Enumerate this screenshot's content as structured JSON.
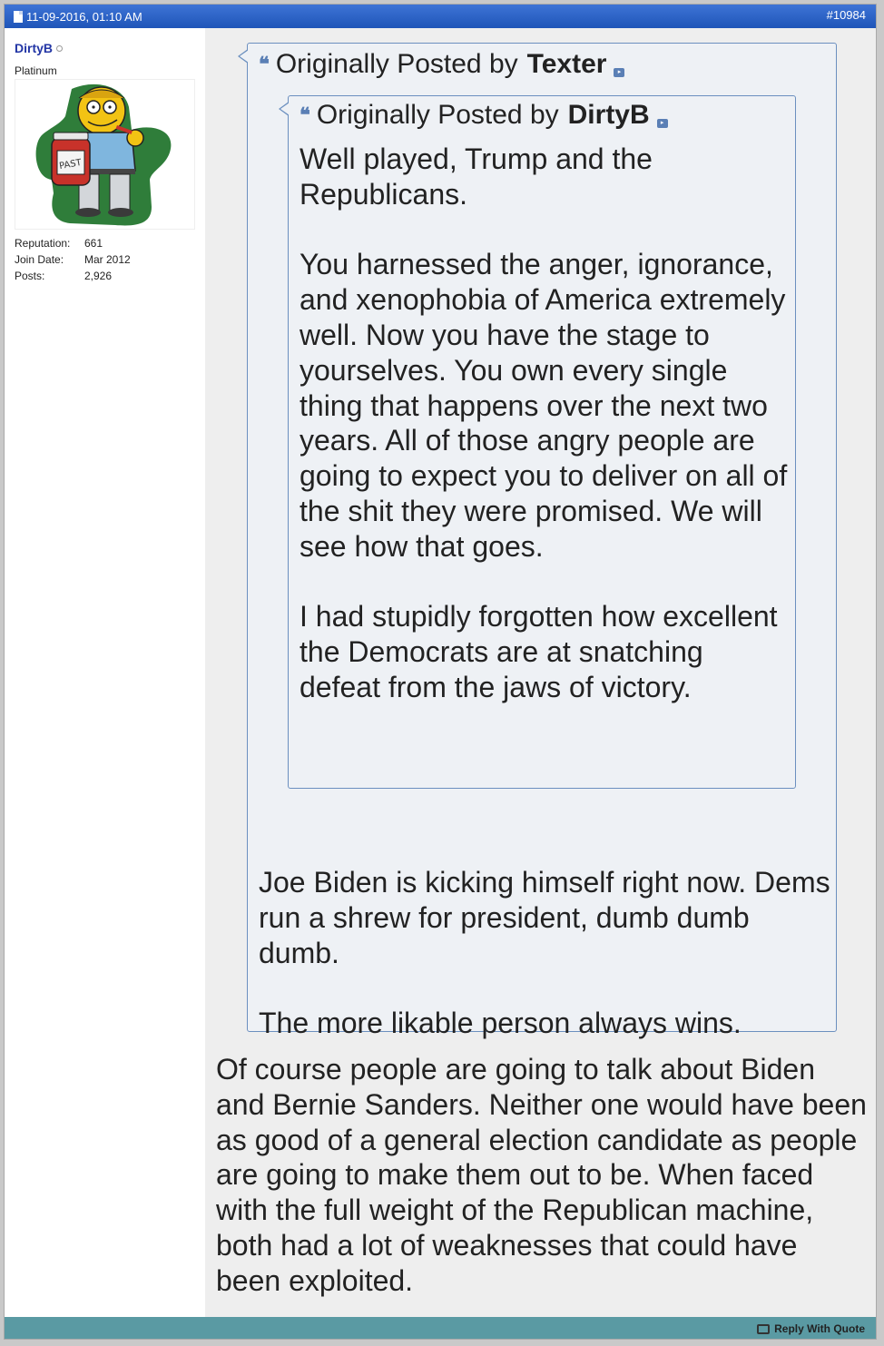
{
  "post": {
    "date": "11-09-2016, 01:10 AM",
    "number": "#10984"
  },
  "user": {
    "name": "DirtyB",
    "title": "Platinum",
    "avatar_text": "PASTE",
    "info": [
      {
        "label": "Reputation:",
        "value": "661"
      },
      {
        "label": "Join Date:",
        "value": "Mar 2012"
      },
      {
        "label": "Posts:",
        "value": "2,926"
      }
    ]
  },
  "outer_quote": {
    "prefix": "Originally Posted by",
    "author": "Texter",
    "paragraphs": [
      "Joe Biden is kicking himself right now. Dems run a shrew for president, dumb dumb dumb.",
      "The more likable person always wins."
    ]
  },
  "inner_quote": {
    "prefix": "Originally Posted by",
    "author": "DirtyB",
    "paragraphs": [
      "Well played, Trump and the Republicans.",
      "You harnessed the anger, ignorance, and xenophobia of America extremely well. Now you have the stage to yourselves. You own every single thing that happens over the next two years. All of those angry people are going to expect you to deliver on all of the shit they were promised. We will see how that goes.",
      "I had stupidly forgotten how excellent the Democrats are at snatching defeat from the jaws of victory."
    ]
  },
  "message": "Of course people are going to talk about Biden and Bernie Sanders. Neither one would have been as good of a general election candidate as people are going to make them out to be. When faced with the full weight of the Republican machine, both had a lot of weaknesses that could have been exploited.",
  "footer": {
    "reply_label": "Reply With Quote"
  },
  "colors": {
    "header": "#2a5fc4",
    "footer": "#5a9aa3",
    "username": "#2235a5",
    "quote_border": "#6b8fbf"
  }
}
